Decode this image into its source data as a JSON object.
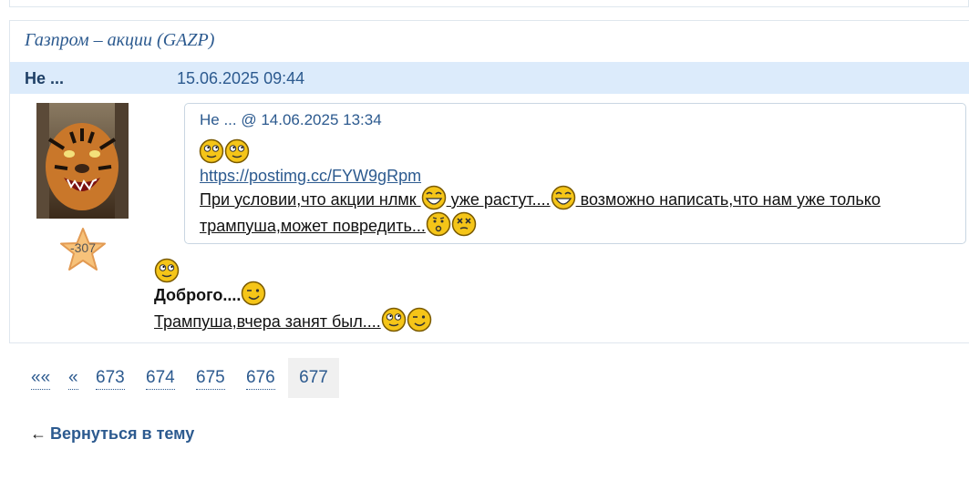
{
  "topic": {
    "title": "Газпром – акции (GAZP)"
  },
  "post": {
    "author": "Не ...",
    "date": "15.06.2025 09:44",
    "reputation": "-307",
    "quote": {
      "header": "Не ... @ 14.06.2025 13:34",
      "link": "https://postimg.cc/FYW9gRpm",
      "line1_a": "При условии,что акции нлмк ",
      "line1_b": " уже растут....",
      "line1_c": " возможно написать,что нам уже только",
      "line2": "трампуша,может повредить..."
    },
    "greeting": "Доброго....",
    "text": "Трампуша,вчера занят был...."
  },
  "pagination": {
    "first": "««",
    "prev": "«",
    "pages": [
      "673",
      "674",
      "675",
      "676"
    ],
    "current": "677"
  },
  "back_link": {
    "arrow": "←",
    "label": "Вернуться в тему"
  },
  "colors": {
    "link": "#2c5a8f",
    "header_bg": "#dcebfb",
    "smiley": "#f5c518"
  }
}
